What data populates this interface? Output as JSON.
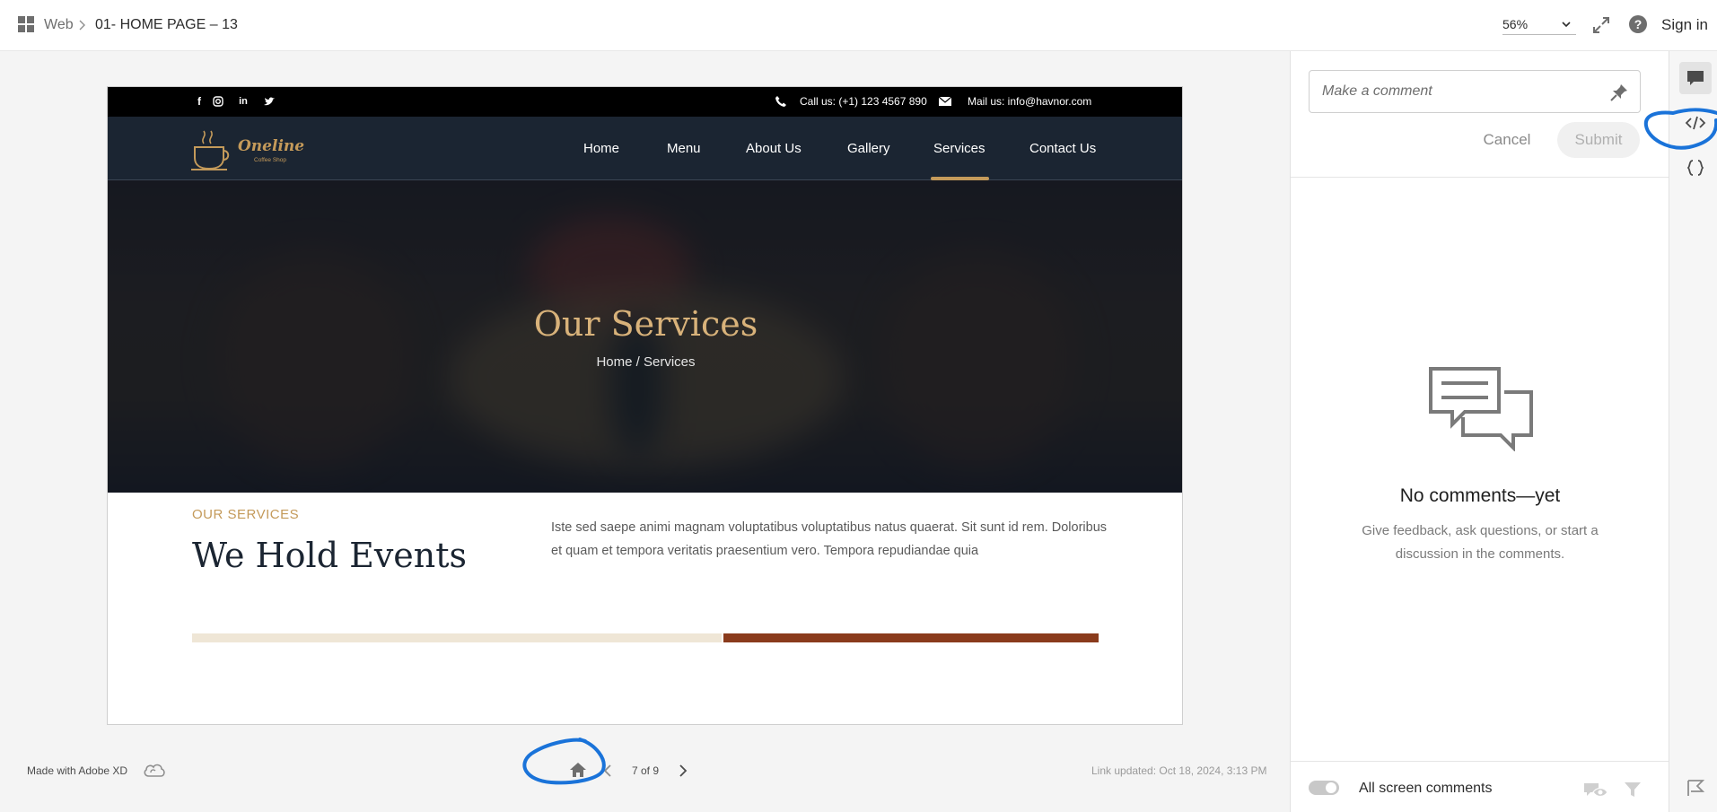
{
  "header": {
    "breadcrumb_root": "Web",
    "breadcrumb_sep": ">",
    "breadcrumb_page": "01- HOME PAGE – 13",
    "zoom": "56%",
    "signin": "Sign in",
    "help": "?"
  },
  "site": {
    "topbar": {
      "phone": "Call us: (+1) 123 4567 890",
      "mail": "Mail us: info@havnor.com"
    },
    "logo_text": "Oneline",
    "logo_sub": "Coffee Shop",
    "nav": [
      "Home",
      "Menu",
      "About Us",
      "Gallery",
      "Services",
      "Contact Us"
    ],
    "active_nav": "Services",
    "hero_title": "Our Services",
    "hero_breadcrumb": "Home / Services",
    "section_kicker": "OUR SERVICES",
    "section_title": "We Hold Events",
    "section_text": "Iste sed saepe animi magnam voluptatibus voluptatibus natus quaerat. Sit sunt id rem. Doloribus et quam et tempora veritatis praesentium vero. Tempora repudiandae quia"
  },
  "footer": {
    "made_with": "Made with Adobe XD",
    "pager": "7 of 9",
    "link_updated": "Link updated: Oct 18, 2024, 3:13 PM"
  },
  "comments": {
    "placeholder": "Make a comment",
    "cancel": "Cancel",
    "submit": "Submit",
    "empty_title": "No comments—yet",
    "empty_desc": "Give feedback, ask questions, or start a discussion in the comments.",
    "all_screen_comments": "All screen comments"
  },
  "icons": {
    "grid": "grid-icon",
    "fullscreen": "expand-icon",
    "home": "home-icon",
    "comment": "comment-icon",
    "code": "code-icon",
    "braces": "braces-icon"
  },
  "colors": {
    "accent_gold": "#c49a5a",
    "nav_bg": "#1b2532",
    "annotation_blue": "#1a73d9"
  }
}
